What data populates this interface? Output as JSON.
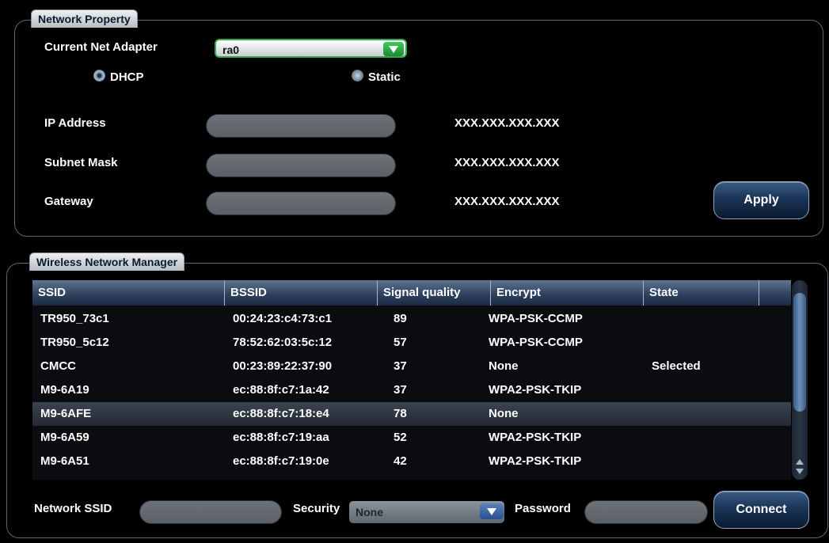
{
  "network_property": {
    "title": "Network Property",
    "current_adapter_label": "Current Net Adapter",
    "current_adapter_value": "ra0",
    "dhcp_label": "DHCP",
    "static_label": "Static",
    "mode_selected": "DHCP",
    "ip_label": "IP Address",
    "ip_value": "",
    "ip_display": "XXX.XXX.XXX.XXX",
    "subnet_label": "Subnet Mask",
    "subnet_value": "",
    "subnet_display": "XXX.XXX.XXX.XXX",
    "gateway_label": "Gateway",
    "gateway_value": "",
    "gateway_display": "XXX.XXX.XXX.XXX",
    "apply_label": "Apply"
  },
  "wireless": {
    "title": "Wireless Network Manager",
    "columns": [
      "SSID",
      "BSSID",
      "Signal quality",
      "Encrypt",
      "State"
    ],
    "rows": [
      [
        "TR950_73c1",
        "00:24:23:c4:73:c1",
        "89",
        "WPA-PSK-CCMP",
        ""
      ],
      [
        "TR950_5c12",
        "78:52:62:03:5c:12",
        "57",
        "WPA-PSK-CCMP",
        ""
      ],
      [
        "CMCC",
        "00:23:89:22:37:90",
        "37",
        "None",
        "Selected"
      ],
      [
        "M9-6A19",
        "ec:88:8f:c7:1a:42",
        "37",
        "WPA2-PSK-TKIP",
        ""
      ],
      [
        "M9-6AFE",
        "ec:88:8f:c7:18:e4",
        "78",
        "None",
        ""
      ],
      [
        "M9-6A59",
        "ec:88:8f:c7:19:aa",
        "52",
        "WPA2-PSK-TKIP",
        ""
      ],
      [
        "M9-6A51",
        "ec:88:8f:c7:19:0e",
        "42",
        "WPA2-PSK-TKIP",
        ""
      ]
    ],
    "highlighted_row": 4,
    "network_ssid_label": "Network SSID",
    "network_ssid_value": "",
    "security_label": "Security",
    "security_value": "None",
    "password_label": "Password",
    "password_value": "",
    "connect_label": "Connect"
  },
  "colors": {
    "background": "#000000",
    "accent_green": "#34a84a",
    "button_blue": "#1b3456",
    "highlight_row": "#2d3541"
  }
}
